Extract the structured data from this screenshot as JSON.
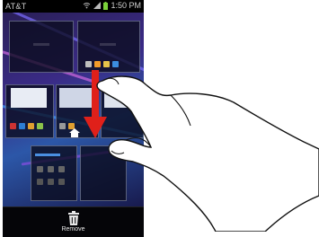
{
  "status_bar": {
    "carrier": "AT&T",
    "time": "1:50 PM",
    "icons": [
      "wifi-icon",
      "signal-icon",
      "battery-icon"
    ]
  },
  "remove_zone": {
    "label": "Remove",
    "icon": "trash-icon"
  },
  "colors": {
    "arrow": "#e0201a",
    "wallpaper_base": "#2a1f57"
  }
}
